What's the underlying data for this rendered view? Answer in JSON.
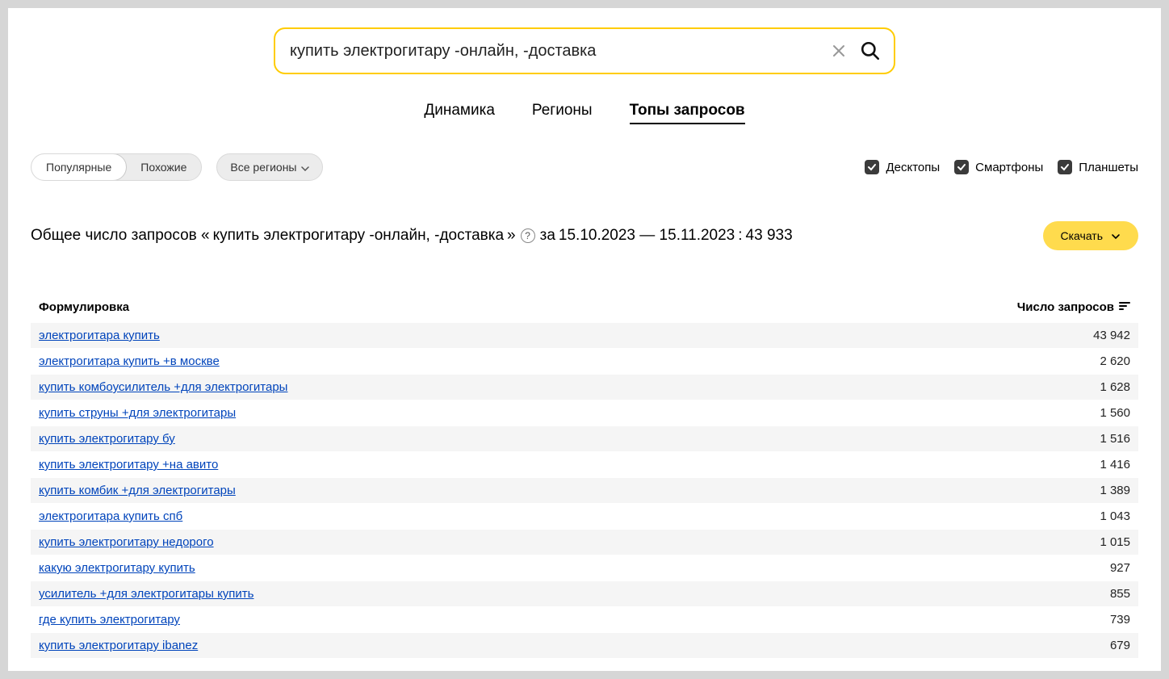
{
  "search": {
    "value": "купить электрогитару -онлайн, -доставка"
  },
  "tabs": {
    "dynamics": "Динамика",
    "regions": "Регионы",
    "tops": "Топы запросов"
  },
  "filters": {
    "popular": "Популярные",
    "similar": "Похожие",
    "all_regions": "Все регионы"
  },
  "devices": {
    "desktops": "Десктопы",
    "smartphones": "Смартфоны",
    "tablets": "Планшеты"
  },
  "summary": {
    "prefix": "Общее число запросов «",
    "query": "купить электрогитару -онлайн, -доставка",
    "postfix_before_help": "»",
    "range_prefix": " за ",
    "range": "15.10.2023 — 15.11.2023",
    "sep": ": ",
    "total": "43 933"
  },
  "download": "Скачать",
  "columns": {
    "query": "Формулировка",
    "count": "Число запросов"
  },
  "rows": [
    {
      "q": "электрогитара купить",
      "c": "43 942"
    },
    {
      "q": "электрогитара купить +в москве",
      "c": "2 620"
    },
    {
      "q": "купить комбоусилитель +для электрогитары",
      "c": "1 628"
    },
    {
      "q": "купить струны +для электрогитары",
      "c": "1 560"
    },
    {
      "q": "купить электрогитару бу",
      "c": "1 516"
    },
    {
      "q": "купить электрогитару +на авито",
      "c": "1 416"
    },
    {
      "q": "купить комбик +для электрогитары",
      "c": "1 389"
    },
    {
      "q": "электрогитара купить спб",
      "c": "1 043"
    },
    {
      "q": "купить электрогитару недорого",
      "c": "1 015"
    },
    {
      "q": "какую электрогитару купить",
      "c": "927"
    },
    {
      "q": "усилитель +для электрогитары купить",
      "c": "855"
    },
    {
      "q": "где купить электрогитару",
      "c": "739"
    },
    {
      "q": "купить электрогитару ibanez",
      "c": "679"
    }
  ]
}
